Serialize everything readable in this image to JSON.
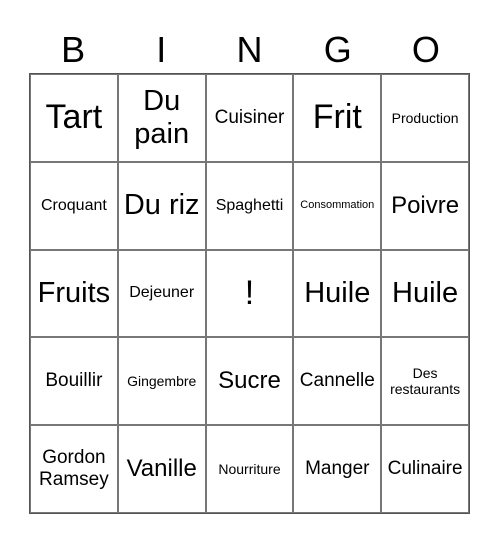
{
  "header": [
    "B",
    "I",
    "N",
    "G",
    "O"
  ],
  "cells": [
    {
      "text": "Tart",
      "size": "xl"
    },
    {
      "text": "Du pain",
      "size": "l"
    },
    {
      "text": "Cuisiner",
      "size": "s"
    },
    {
      "text": "Frit",
      "size": "xl"
    },
    {
      "text": "Production",
      "size": "xxs"
    },
    {
      "text": "Croquant",
      "size": "xs"
    },
    {
      "text": "Du riz",
      "size": "l"
    },
    {
      "text": "Spaghetti",
      "size": "xs"
    },
    {
      "text": "Consommation",
      "size": "tiny"
    },
    {
      "text": "Poivre",
      "size": "m"
    },
    {
      "text": "Fruits",
      "size": "l"
    },
    {
      "text": "Dejeuner",
      "size": "xs"
    },
    {
      "text": "!",
      "size": "xl"
    },
    {
      "text": "Huile",
      "size": "l"
    },
    {
      "text": "Huile",
      "size": "l"
    },
    {
      "text": "Bouillir",
      "size": "s"
    },
    {
      "text": "Gingembre",
      "size": "xxs"
    },
    {
      "text": "Sucre",
      "size": "m"
    },
    {
      "text": "Cannelle",
      "size": "s"
    },
    {
      "text": "Des restaurants",
      "size": "xxs"
    },
    {
      "text": "Gordon Ramsey",
      "size": "s"
    },
    {
      "text": "Vanille",
      "size": "m"
    },
    {
      "text": "Nourriture",
      "size": "xxs"
    },
    {
      "text": "Manger",
      "size": "s"
    },
    {
      "text": "Culinaire",
      "size": "s"
    }
  ]
}
